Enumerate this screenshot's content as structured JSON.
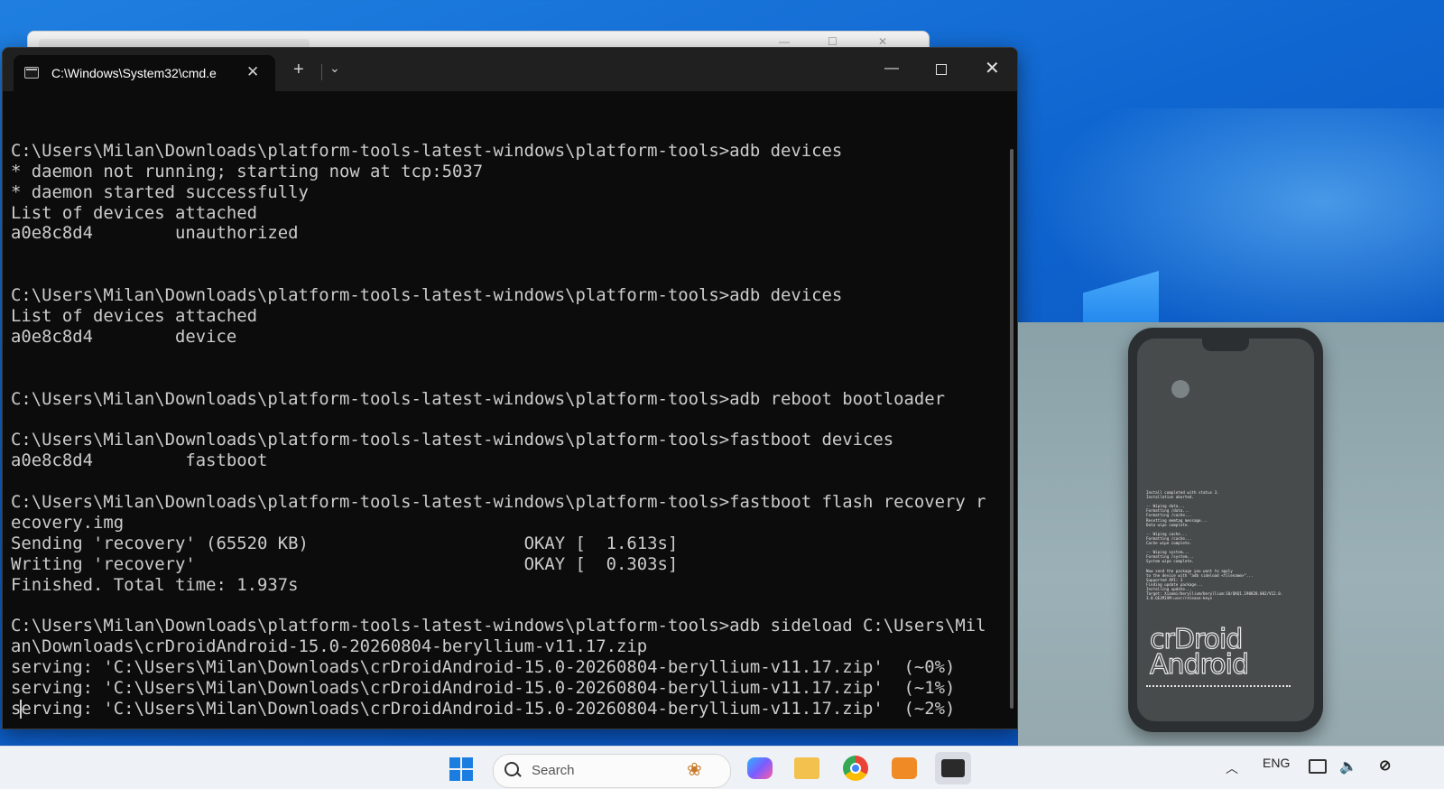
{
  "terminal": {
    "tab_title": "C:\\Windows\\System32\\cmd.e",
    "new_tab_glyph": "+",
    "dropdown_glyph": "⌄",
    "close_tab_glyph": "✕",
    "lines": [
      "",
      "C:\\Users\\Milan\\Downloads\\platform-tools-latest-windows\\platform-tools>adb devices",
      "* daemon not running; starting now at tcp:5037",
      "* daemon started successfully",
      "List of devices attached",
      "a0e8c8d4        unauthorized",
      "",
      "",
      "C:\\Users\\Milan\\Downloads\\platform-tools-latest-windows\\platform-tools>adb devices",
      "List of devices attached",
      "a0e8c8d4        device",
      "",
      "",
      "C:\\Users\\Milan\\Downloads\\platform-tools-latest-windows\\platform-tools>adb reboot bootloader",
      "",
      "C:\\Users\\Milan\\Downloads\\platform-tools-latest-windows\\platform-tools>fastboot devices",
      "a0e8c8d4         fastboot",
      "",
      "C:\\Users\\Milan\\Downloads\\platform-tools-latest-windows\\platform-tools>fastboot flash recovery r",
      "ecovery.img",
      "Sending 'recovery' (65520 KB)                     OKAY [  1.613s]",
      "Writing 'recovery'                                OKAY [  0.303s]",
      "Finished. Total time: 1.937s",
      "",
      "C:\\Users\\Milan\\Downloads\\platform-tools-latest-windows\\platform-tools>adb sideload C:\\Users\\Mil",
      "an\\Downloads\\crDroidAndroid-15.0-20260804-beryllium-v11.17.zip",
      "serving: 'C:\\Users\\Milan\\Downloads\\crDroidAndroid-15.0-20260804-beryllium-v11.17.zip'  (~0%)",
      "serving: 'C:\\Users\\Milan\\Downloads\\crDroidAndroid-15.0-20260804-beryllium-v11.17.zip'  (~1%)",
      "serving: 'C:\\Users\\Milan\\Downloads\\crDroidAndroid-15.0-20260804-beryllium-v11.17.zip'  (~2%)"
    ]
  },
  "phone": {
    "recovery_log": "Install completed with status 3.\nInstallation aborted.\n\n-- Wiping data...\nFormatting /data...\nFormatting /cache...\nResetting memtag message...\nData wipe complete.\n\n-- Wiping cache...\nFormatting /cache...\nCache wipe complete.\n\n-- Wiping system...\nFormatting /system...\nSystem wipe complete.\n\nNow send the package you want to apply\nto the device with \"adb sideload <filename>\"...\nSupported API: 3\nFinding update package...\nInstalling update...\nTarget: Xiaomi/beryllium/beryllium:10/QKQ1.190828.002/V12.0.\n3.0.QEJMIXM:user/release-keys",
    "logo_line1": "crDroid",
    "logo_line2": "Android"
  },
  "taskbar": {
    "search_placeholder": "Search",
    "language": "ENG"
  },
  "colors": {
    "terminal_bg": "#0c0c0c",
    "terminal_text": "#cccccc",
    "titlebar_bg": "#202020",
    "wallpaper": "#1066d0"
  }
}
